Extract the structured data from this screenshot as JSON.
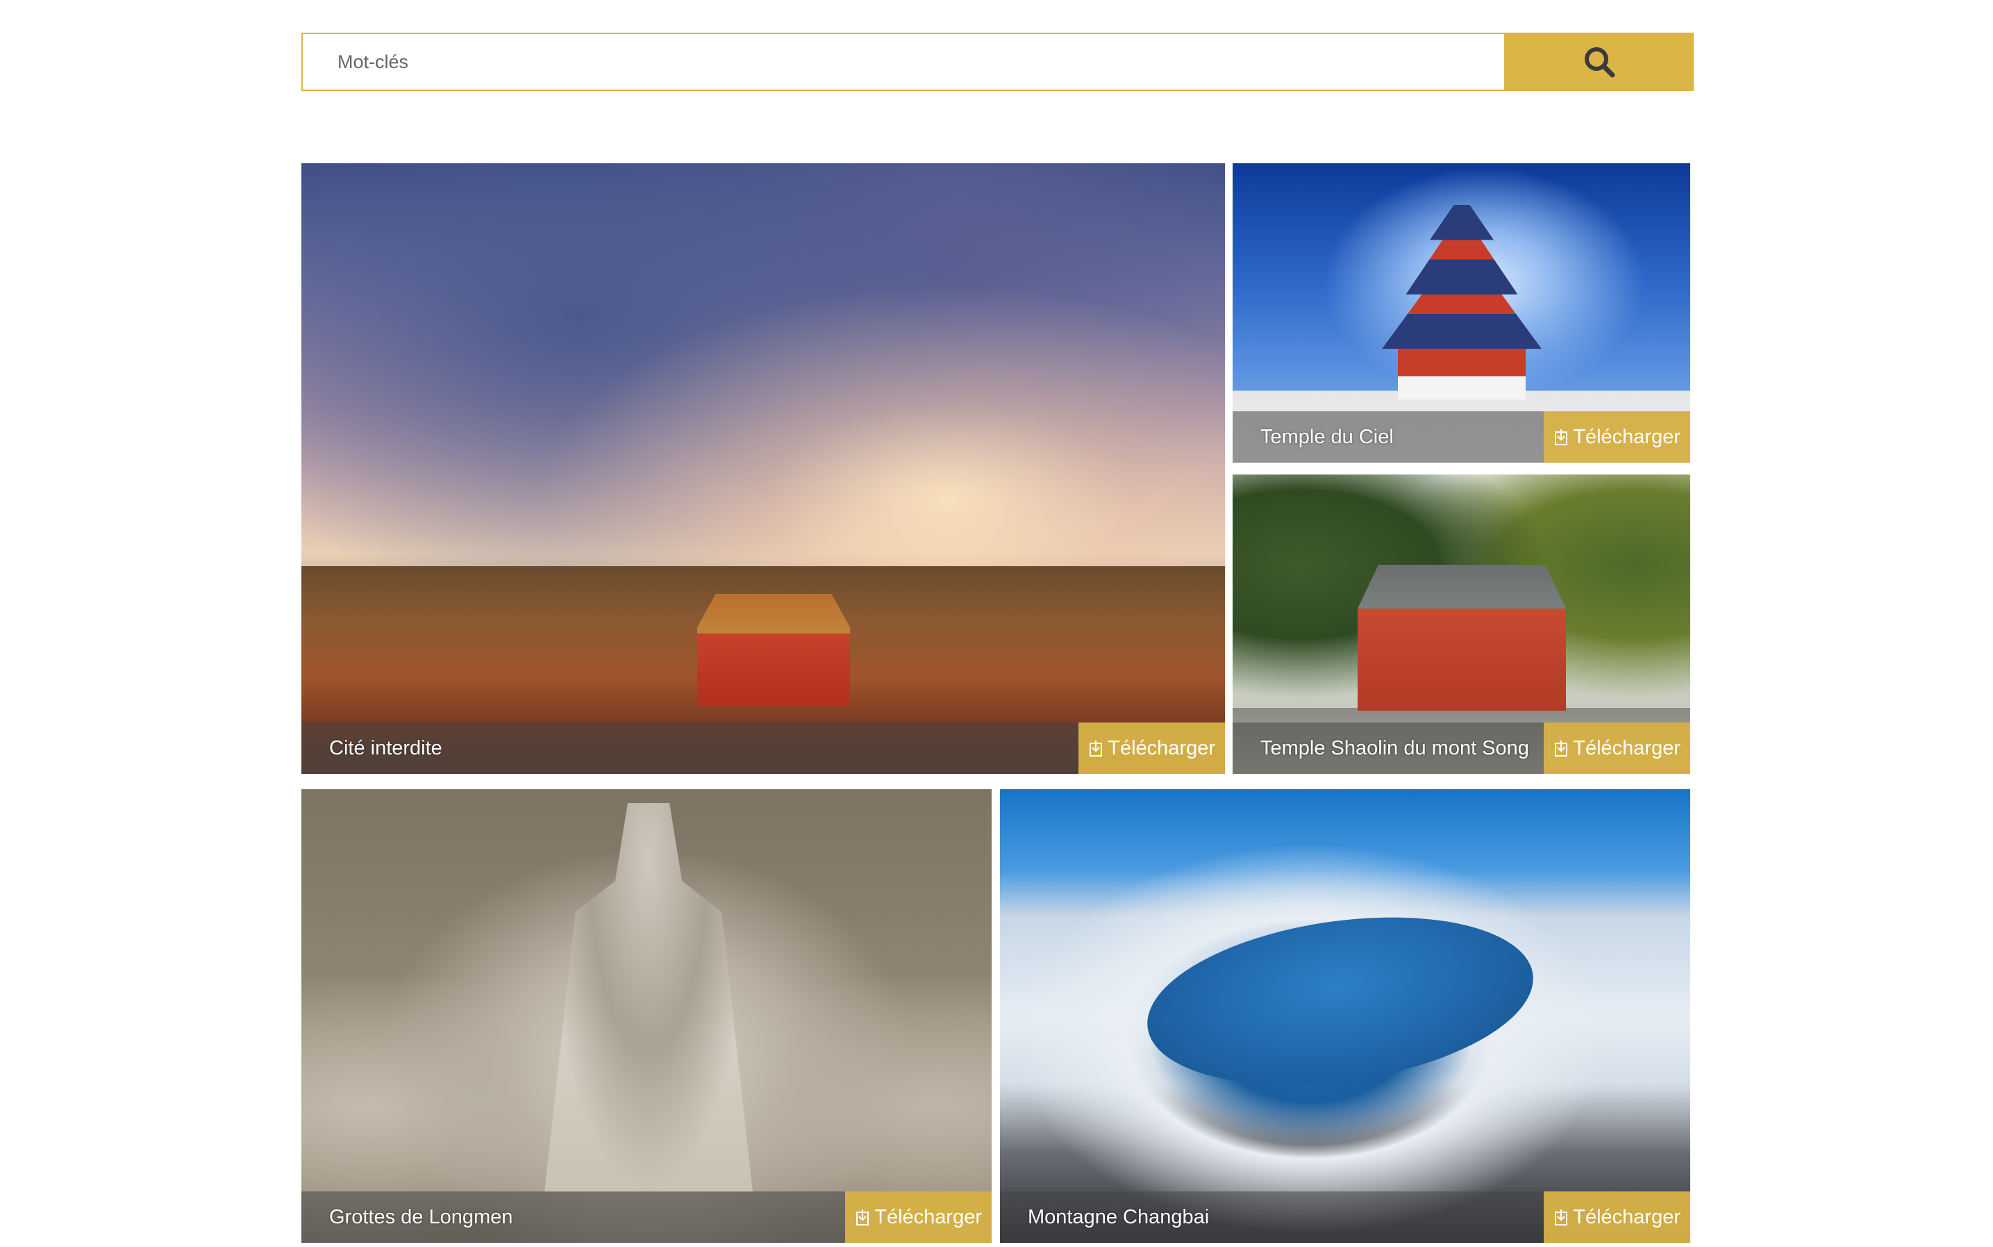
{
  "search": {
    "placeholder": "Mot-clés",
    "button_icon": "search-icon"
  },
  "colors": {
    "accent": "#dcb547"
  },
  "gallery": [
    {
      "caption": "Cité interdite",
      "download_label": "Télécharger",
      "download_icon": "download-icon"
    },
    {
      "caption": "Temple du Ciel",
      "download_label": "Télécharger",
      "download_icon": "download-icon"
    },
    {
      "caption": "Temple Shaolin du mont Song",
      "download_label": "Télécharger",
      "download_icon": "download-icon"
    },
    {
      "caption": "Grottes de Longmen",
      "download_label": "Télécharger",
      "download_icon": "download-icon"
    },
    {
      "caption": "Montagne Changbai",
      "download_label": "Télécharger",
      "download_icon": "download-icon"
    }
  ]
}
